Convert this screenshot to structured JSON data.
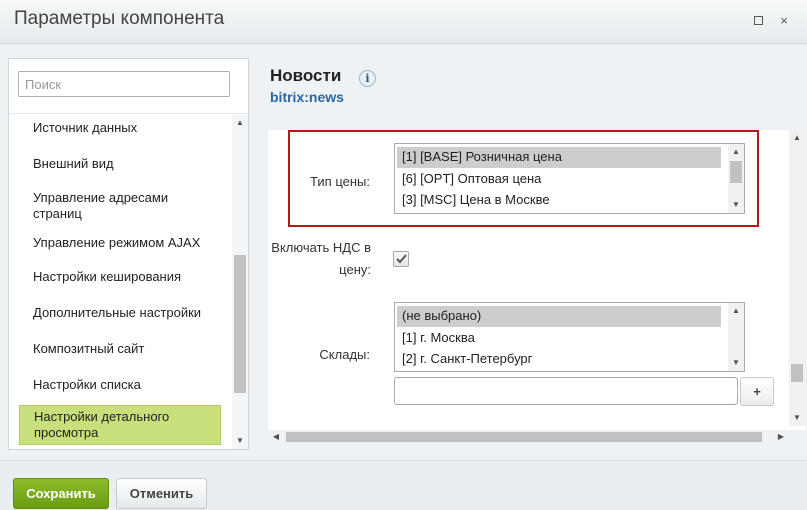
{
  "window": {
    "title": "Параметры компонента",
    "maximize_icon": "maximize-icon",
    "close_icon": "close-icon",
    "close_glyph": "×"
  },
  "sidebar": {
    "search_placeholder": "Поиск",
    "items": [
      {
        "label": "Источник данных",
        "active": false
      },
      {
        "label": "Внешний вид",
        "active": false
      },
      {
        "label": "Управление адресами страниц",
        "active": false
      },
      {
        "label": "Управление режимом AJAX",
        "active": false
      },
      {
        "label": "Настройки кеширования",
        "active": false
      },
      {
        "label": "Дополнительные настройки",
        "active": false
      },
      {
        "label": "Композитный сайт",
        "active": false
      },
      {
        "label": "Настройки списка",
        "active": false
      },
      {
        "label": "Настройки детального просмотра",
        "active": true
      }
    ],
    "active_color": "#c8e07c"
  },
  "component": {
    "title": "Новости",
    "info_glyph": "i",
    "code": "bitrix:news"
  },
  "params": {
    "price_type": {
      "label": "Тип цены:",
      "options": [
        {
          "text": "[1] [BASE] Розничная цена",
          "selected": true
        },
        {
          "text": "[6] [OPT] Оптовая цена",
          "selected": false
        },
        {
          "text": "[3] [MSC] Цена в Москве",
          "selected": false
        }
      ]
    },
    "vat": {
      "label_line1": "Включать НДС в",
      "label_line2": "цену:",
      "checked": true
    },
    "stores": {
      "label": "Склады:",
      "options": [
        {
          "text": "(не выбрано)",
          "selected": true
        },
        {
          "text": "[1] г. Москва",
          "selected": false
        },
        {
          "text": "[2] г. Санкт-Петербург",
          "selected": false
        }
      ],
      "input_value": "",
      "add_label": "+"
    },
    "highlight_color": "#b31919"
  },
  "footer": {
    "save_label": "Сохранить",
    "cancel_label": "Отменить",
    "save_color": "#7aac1f"
  }
}
